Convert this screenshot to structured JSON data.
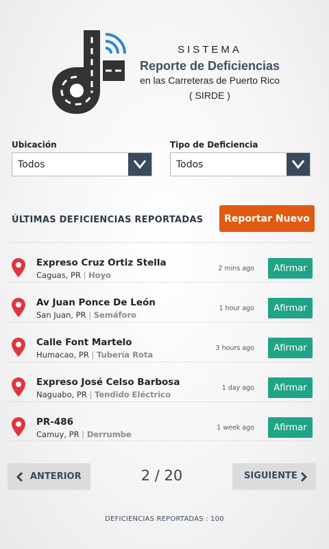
{
  "header": {
    "line1": "SISTEMA",
    "line2": "Reporte de Deficiencias",
    "line3": "en las Carreteras de Puerto Rico",
    "line4": "( SIRDE )",
    "logo_icon": "road-signal-logo"
  },
  "filters": {
    "location": {
      "label": "Ubicación",
      "value": "Todos"
    },
    "type": {
      "label": "Tipo de Deficiencia",
      "value": "Todos"
    }
  },
  "section": {
    "title": "ÚLTIMAS DEFICIENCIAS REPORTADAS",
    "report_new": "Reportar Nuevo"
  },
  "reports": [
    {
      "title": "Expreso Cruz Ortiz Stella",
      "location": "Caguas, PR",
      "type": "Hoyo",
      "time": "2 mins ago",
      "action": "Afirmar"
    },
    {
      "title": "Av Juan Ponce De León",
      "location": "San Juan, PR",
      "type": "Semáforo",
      "time": "1 hour ago",
      "action": "Afirmar"
    },
    {
      "title": "Calle Font Martelo",
      "location": "Humacao, PR",
      "type": "Tubería Rota",
      "time": "3 hours ago",
      "action": "Afirmar"
    },
    {
      "title": "Expreso José Celso Barbosa",
      "location": "Naguabo, PR",
      "type": "Tendido Eléctrico",
      "time": "1 day ago",
      "action": "Afirmar"
    },
    {
      "title": "PR-486",
      "location": "Camuy, PR",
      "type": "Derrumbe",
      "time": "1 week ago",
      "action": "Afirmar"
    }
  ],
  "pagination": {
    "prev": "ANTERIOR",
    "next": "SIGUIENTE",
    "indicator": "2 / 20"
  },
  "footer": "DEFICIENCIAS REPORTADAS : 100",
  "colors": {
    "accent_orange": "#e05a12",
    "affirm_green": "#20a386",
    "dark_slate": "#3a4a5c",
    "pin_red": "#e0353f",
    "signal_blue": "#2e86d1"
  }
}
